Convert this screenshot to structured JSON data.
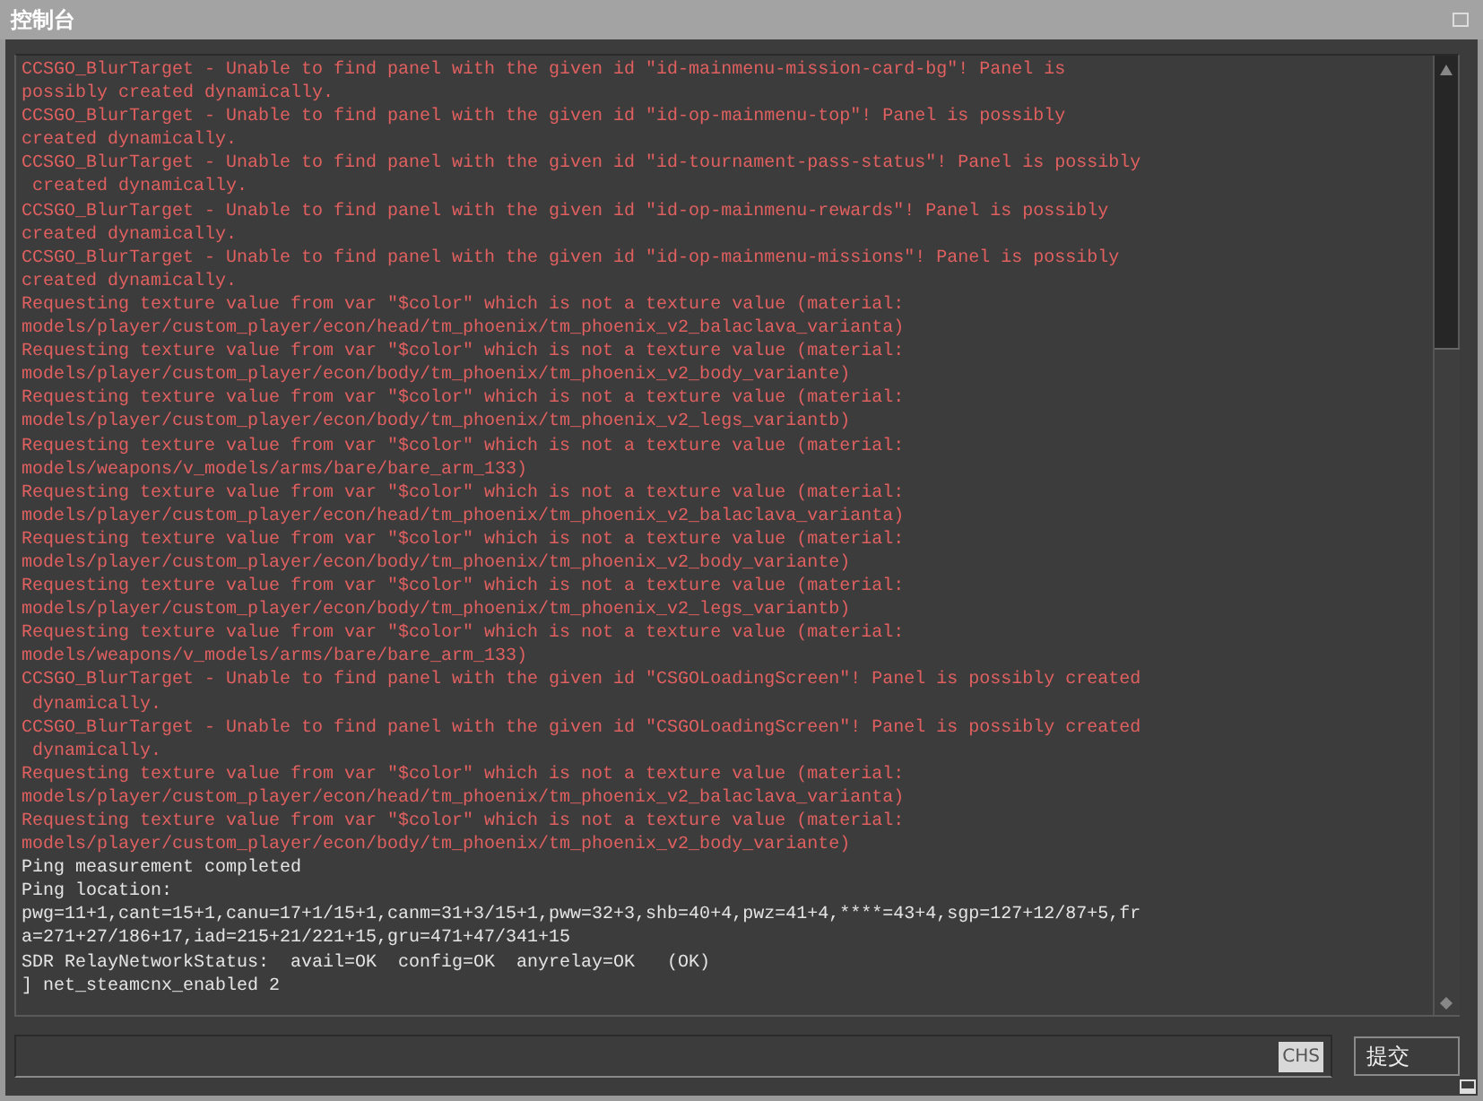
{
  "window": {
    "title": "控制台"
  },
  "log": [
    {
      "kind": "error",
      "text": "CCSGO_BlurTarget - Unable to find panel with the given id \"id-mainmenu-mission-card-bg\"! Panel is\npossibly created dynamically."
    },
    {
      "kind": "error",
      "text": "CCSGO_BlurTarget - Unable to find panel with the given id \"id-op-mainmenu-top\"! Panel is possibly\ncreated dynamically."
    },
    {
      "kind": "error",
      "text": "CCSGO_BlurTarget - Unable to find panel with the given id \"id-tournament-pass-status\"! Panel is possibly\n created dynamically."
    },
    {
      "kind": "error",
      "text": "CCSGO_BlurTarget - Unable to find panel with the given id \"id-op-mainmenu-rewards\"! Panel is possibly\ncreated dynamically."
    },
    {
      "kind": "error",
      "text": "CCSGO_BlurTarget - Unable to find panel with the given id \"id-op-mainmenu-missions\"! Panel is possibly\ncreated dynamically."
    },
    {
      "kind": "error",
      "text": "Requesting texture value from var \"$color\" which is not a texture value (material:\nmodels/player/custom_player/econ/head/tm_phoenix/tm_phoenix_v2_balaclava_varianta)"
    },
    {
      "kind": "error",
      "text": "Requesting texture value from var \"$color\" which is not a texture value (material:\nmodels/player/custom_player/econ/body/tm_phoenix/tm_phoenix_v2_body_variante)"
    },
    {
      "kind": "error",
      "text": "Requesting texture value from var \"$color\" which is not a texture value (material:\nmodels/player/custom_player/econ/body/tm_phoenix/tm_phoenix_v2_legs_variantb)"
    },
    {
      "kind": "error",
      "text": "Requesting texture value from var \"$color\" which is not a texture value (material:\nmodels/weapons/v_models/arms/bare/bare_arm_133)"
    },
    {
      "kind": "error",
      "text": "Requesting texture value from var \"$color\" which is not a texture value (material:\nmodels/player/custom_player/econ/head/tm_phoenix/tm_phoenix_v2_balaclava_varianta)"
    },
    {
      "kind": "error",
      "text": "Requesting texture value from var \"$color\" which is not a texture value (material:\nmodels/player/custom_player/econ/body/tm_phoenix/tm_phoenix_v2_body_variante)"
    },
    {
      "kind": "error",
      "text": "Requesting texture value from var \"$color\" which is not a texture value (material:\nmodels/player/custom_player/econ/body/tm_phoenix/tm_phoenix_v2_legs_variantb)"
    },
    {
      "kind": "error",
      "text": "Requesting texture value from var \"$color\" which is not a texture value (material:\nmodels/weapons/v_models/arms/bare/bare_arm_133)"
    },
    {
      "kind": "error",
      "text": "CCSGO_BlurTarget - Unable to find panel with the given id \"CSGOLoadingScreen\"! Panel is possibly created\n dynamically."
    },
    {
      "kind": "error",
      "text": "CCSGO_BlurTarget - Unable to find panel with the given id \"CSGOLoadingScreen\"! Panel is possibly created\n dynamically."
    },
    {
      "kind": "error",
      "text": "Requesting texture value from var \"$color\" which is not a texture value (material:\nmodels/player/custom_player/econ/head/tm_phoenix/tm_phoenix_v2_balaclava_varianta)"
    },
    {
      "kind": "error",
      "text": "Requesting texture value from var \"$color\" which is not a texture value (material:\nmodels/player/custom_player/econ/body/tm_phoenix/tm_phoenix_v2_body_variante)"
    },
    {
      "kind": "info",
      "text": "Ping measurement completed"
    },
    {
      "kind": "info",
      "text": "Ping location:"
    },
    {
      "kind": "info",
      "text": "pwg=11+1,cant=15+1,canu=17+1/15+1,canm=31+3/15+1,pww=32+3,shb=40+4,pwz=41+4,****=43+4,sgp=127+12/87+5,fr\na=271+27/186+17,iad=215+21/221+15,gru=471+47/341+15"
    },
    {
      "kind": "info",
      "text": "SDR RelayNetworkStatus:  avail=OK  config=OK  anyrelay=OK   (OK)"
    },
    {
      "kind": "info",
      "text": "] net_steamcnx_enabled 2"
    }
  ],
  "input": {
    "ime_badge": "CHS"
  },
  "submit_button": "提交"
}
